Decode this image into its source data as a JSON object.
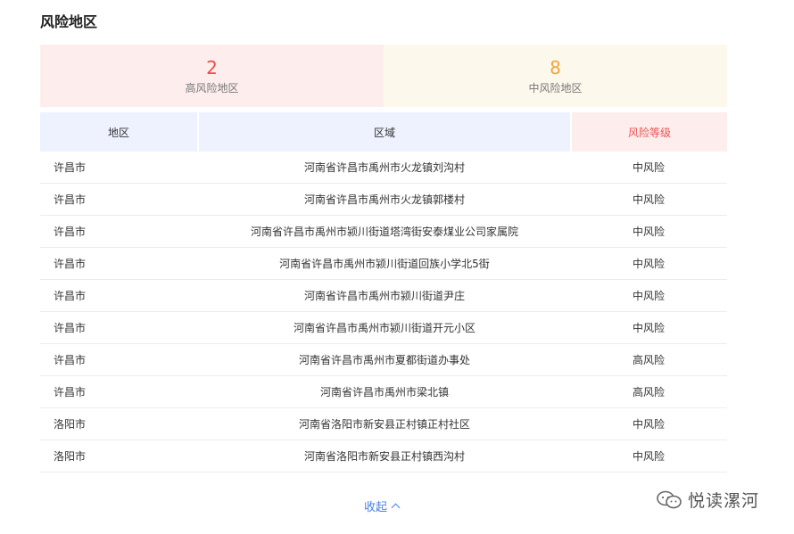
{
  "section": {
    "title": "风险地区"
  },
  "summary": {
    "high": {
      "count": "2",
      "label": "高风险地区"
    },
    "mid": {
      "count": "8",
      "label": "中风险地区"
    }
  },
  "table": {
    "headers": {
      "region": "地区",
      "area": "区域",
      "level": "风险等级"
    },
    "rows": [
      {
        "region": "许昌市",
        "area": "河南省许昌市禹州市火龙镇刘沟村",
        "level": "中风险"
      },
      {
        "region": "许昌市",
        "area": "河南省许昌市禹州市火龙镇郭楼村",
        "level": "中风险"
      },
      {
        "region": "许昌市",
        "area": "河南省许昌市禹州市颍川街道塔湾街安泰煤业公司家属院",
        "level": "中风险"
      },
      {
        "region": "许昌市",
        "area": "河南省许昌市禹州市颍川街道回族小学北5街",
        "level": "中风险"
      },
      {
        "region": "许昌市",
        "area": "河南省许昌市禹州市颍川街道尹庄",
        "level": "中风险"
      },
      {
        "region": "许昌市",
        "area": "河南省许昌市禹州市颍川街道开元小区",
        "level": "中风险"
      },
      {
        "region": "许昌市",
        "area": "河南省许昌市禹州市夏都街道办事处",
        "level": "高风险"
      },
      {
        "region": "许昌市",
        "area": "河南省许昌市禹州市梁北镇",
        "level": "高风险"
      },
      {
        "region": "洛阳市",
        "area": "河南省洛阳市新安县正村镇正村社区",
        "level": "中风险"
      },
      {
        "region": "洛阳市",
        "area": "河南省洛阳市新安县正村镇西沟村",
        "level": "中风险"
      }
    ]
  },
  "footer": {
    "collapse_label": "收起",
    "collapse_icon": "chevron-up-icon"
  },
  "watermark": {
    "text": "悦读漯河",
    "icon": "wechat-icon"
  },
  "colors": {
    "high": "#f24a4a",
    "mid": "#f2a43a",
    "link": "#4a7fe6"
  }
}
